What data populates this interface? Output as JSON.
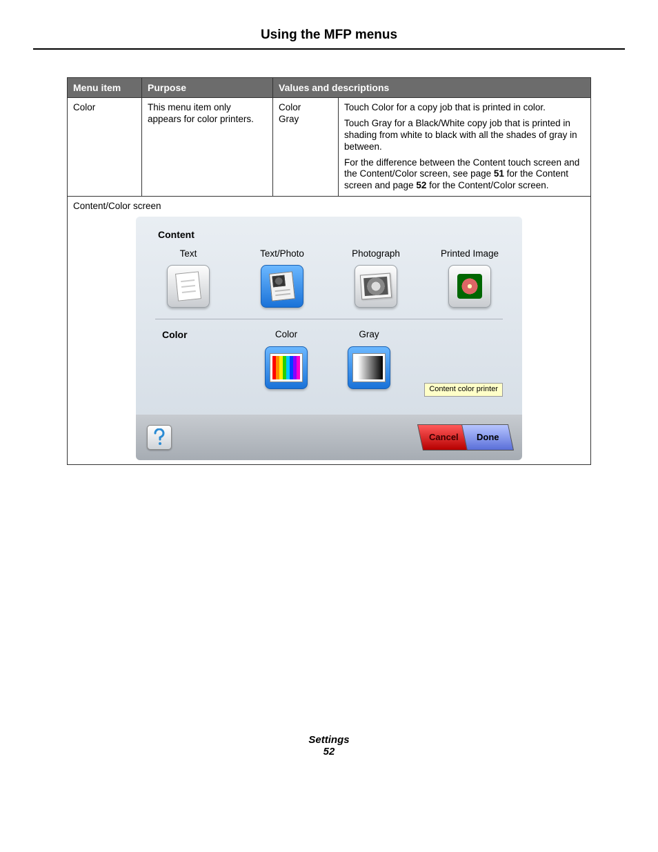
{
  "page": {
    "title": "Using the MFP menus",
    "footer_label": "Settings",
    "page_number": "52"
  },
  "table": {
    "headers": {
      "menu_item": "Menu item",
      "purpose": "Purpose",
      "values_desc": "Values and descriptions"
    },
    "row": {
      "menu_item": "Color",
      "purpose": "This menu item only appears for color printers.",
      "values": [
        "Color",
        "Gray"
      ],
      "desc_p1": "Touch Color for a copy job that is printed in color.",
      "desc_p2": "Touch Gray for a Black/White copy job that is printed in shading from white to black with all the shades of gray in between.",
      "desc_p3a": "For the difference between the Content touch screen and the Content/Color screen, see page ",
      "desc_p3_pg1": "51",
      "desc_p3b": " for the Content screen and page ",
      "desc_p3_pg2": "52",
      "desc_p3c": " for the Content/Color screen."
    },
    "screen_label": "Content/Color screen"
  },
  "touchscreen": {
    "content_title": "Content",
    "content_options": [
      {
        "label": "Text",
        "selected": false,
        "icon": "page"
      },
      {
        "label": "Text/Photo",
        "selected": true,
        "icon": "textphoto"
      },
      {
        "label": "Photograph",
        "selected": false,
        "icon": "photo"
      },
      {
        "label": "Printed Image",
        "selected": false,
        "icon": "flower"
      }
    ],
    "color_title": "Color",
    "color_options": [
      {
        "label": "Color",
        "selected": true,
        "icon": "spectrum"
      },
      {
        "label": "Gray",
        "selected": true,
        "icon": "grayscale"
      }
    ],
    "tooltip": "Content color printer",
    "cancel": "Cancel",
    "done": "Done"
  }
}
